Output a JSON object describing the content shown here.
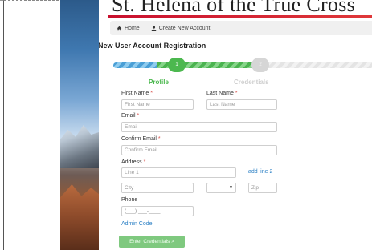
{
  "site": {
    "title": "St. Helena of the True Cross"
  },
  "breadcrumb": {
    "home": "Home",
    "create": "Create New Account"
  },
  "page": {
    "title": "New User Account Registration"
  },
  "steps": [
    {
      "number": "1",
      "label": "Profile",
      "state": "active"
    },
    {
      "number": "2",
      "label": "Credentials",
      "state": "inactive"
    }
  ],
  "form": {
    "first_name_label": "First Name",
    "first_name_placeholder": "First Name",
    "last_name_label": "Last Name",
    "last_name_placeholder": "Last Name",
    "email_label": "Email",
    "email_placeholder": "Email",
    "confirm_email_label": "Confirm Email",
    "confirm_email_placeholder": "Confirm Email",
    "address_label": "Address",
    "line1_placeholder": "Line 1",
    "add_line2": "add line 2",
    "city_placeholder": "City",
    "state_value": "",
    "zip_placeholder": "Zip",
    "phone_label": "Phone",
    "phone_placeholder": "(___) ___-____",
    "admin_code": "Admin Code",
    "required_marker": "*",
    "submit_label": "Enter Credentials >"
  },
  "colors": {
    "accent_green": "#4cb84f",
    "link_blue": "#2a7fc4",
    "required_red": "#d9534f",
    "title_rule": "#c8102e"
  }
}
